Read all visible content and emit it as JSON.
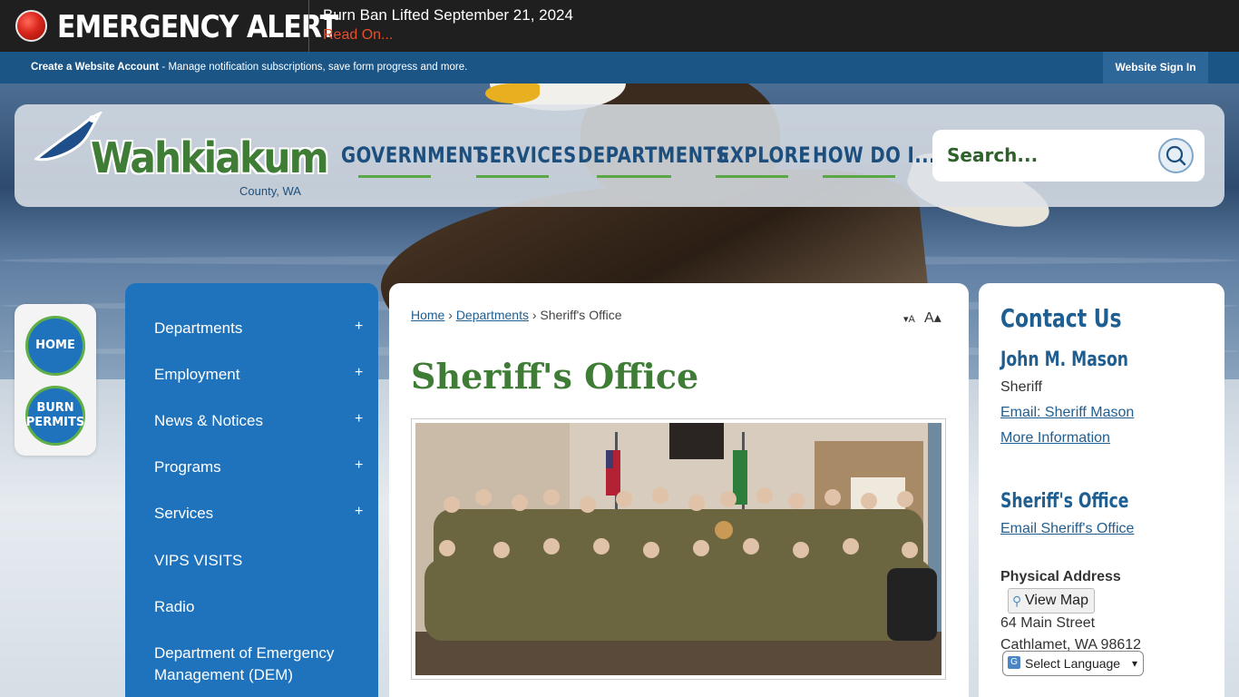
{
  "alert": {
    "title": "EMERGENCY ALERT",
    "headline": "Burn Ban Lifted September 21, 2024",
    "link": "Read On..."
  },
  "account": {
    "create_label": "Create a Website Account",
    "create_desc": " - Manage notification subscriptions, save form progress and more.",
    "signin": "Website Sign In"
  },
  "logo": {
    "name": "Wahkiakum",
    "sub": "County, WA"
  },
  "nav": [
    "GOVERNMENT",
    "SERVICES",
    "DEPARTMENTS",
    "EXPLORE",
    "HOW DO I..."
  ],
  "search": {
    "placeholder": "Search..."
  },
  "quick_links": [
    {
      "line1": "HOME",
      "line2": ""
    },
    {
      "line1": "BURN",
      "line2": "PERMITS"
    }
  ],
  "side_nav": [
    {
      "label": "Departments",
      "expand": "+"
    },
    {
      "label": "Employment",
      "expand": "+"
    },
    {
      "label": "News & Notices",
      "expand": "+"
    },
    {
      "label": "Programs",
      "expand": "+"
    },
    {
      "label": "Services",
      "expand": "+"
    },
    {
      "label": "VIPS VISITS",
      "expand": ""
    },
    {
      "label": "Radio",
      "expand": ""
    },
    {
      "label": "Department of Emergency Management (DEM)",
      "expand": ""
    }
  ],
  "breadcrumb": {
    "home": "Home",
    "departments": "Departments",
    "current": "Sheriff's Office",
    "sep": "›"
  },
  "text_size": {
    "decrease": "▾A",
    "increase": "A▴"
  },
  "page": {
    "title": "Sheriff's Office"
  },
  "contact": {
    "title": "Contact Us",
    "person_name": "John M. Mason",
    "person_role": "Sheriff",
    "email_link": "Email: Sheriff Mason",
    "more_info": "More Information",
    "office_name": "Sheriff's Office",
    "office_email": "Email Sheriff's Office",
    "address_label": "Physical Address",
    "map_button": "View Map",
    "street": "64 Main Street",
    "city": "Cathlamet, WA 98612"
  },
  "language": {
    "label": "Select Language"
  },
  "colors": {
    "brand_blue": "#1f73bc",
    "brand_green": "#3f7d36",
    "alert_red": "#e84f2b"
  }
}
